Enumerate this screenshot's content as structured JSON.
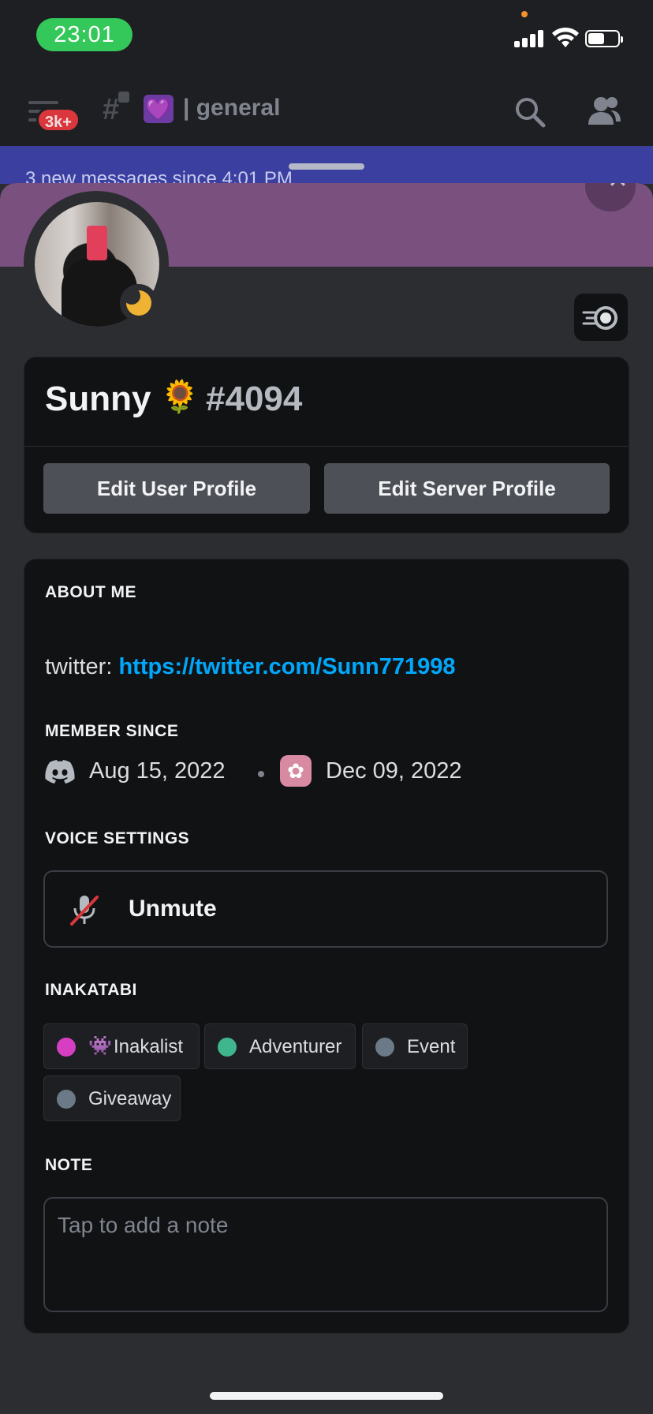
{
  "status_bar": {
    "time": "23:01"
  },
  "header": {
    "badge": "3k+",
    "channel_emoji": "💜",
    "channel_name": "| general"
  },
  "new_messages": {
    "text": "3 new messages since 4:01 PM"
  },
  "profile": {
    "display_name": "Sunny",
    "name_emoji": "🌻",
    "discriminator": "#4094",
    "edit_user_profile": "Edit User Profile",
    "edit_server_profile": "Edit Server Profile"
  },
  "about": {
    "title": "ABOUT ME",
    "prefix": "twitter: ",
    "link": "https://twitter.com/Sunn771998"
  },
  "member_since": {
    "title": "MEMBER SINCE",
    "discord_date": "Aug 15, 2022",
    "server_date": "Dec 09, 2022"
  },
  "voice": {
    "title": "VOICE SETTINGS",
    "unmute_label": "Unmute"
  },
  "roles": {
    "title": "INAKATABI",
    "items": [
      {
        "emoji": "👾",
        "label": "Inakalist",
        "color": "#d63fc2"
      },
      {
        "label": "Adventurer",
        "color": "#3fb68e"
      },
      {
        "label": "Event",
        "color": "#6b7a86"
      },
      {
        "label": "Giveaway",
        "color": "#6b7a86"
      }
    ]
  },
  "note": {
    "title": "NOTE",
    "placeholder": "Tap to add a note"
  },
  "colors": {
    "background": "#2b2d31",
    "card": "#111214",
    "banner": "#79507e",
    "button": "#4e5058",
    "link": "#00a8fc",
    "status_idle": "#f0b232",
    "time_pill": "#34c759"
  }
}
